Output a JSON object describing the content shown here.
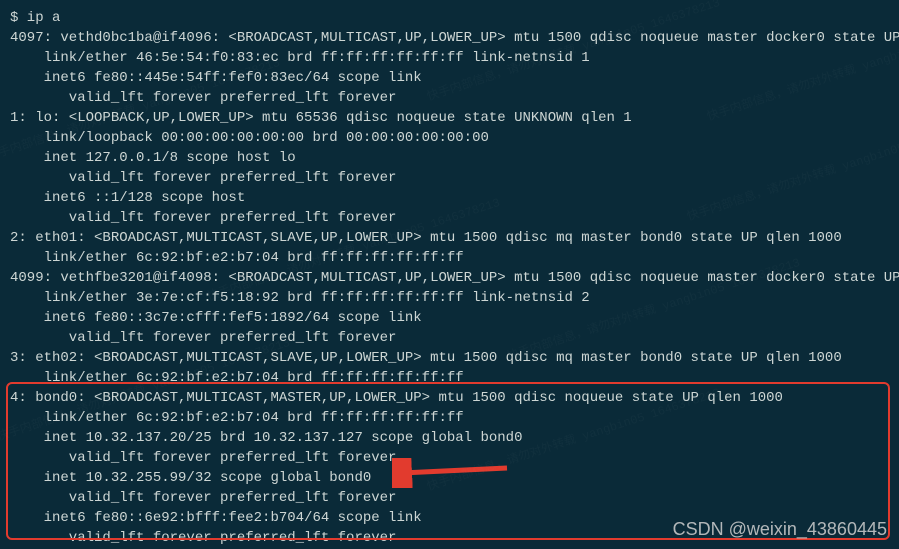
{
  "prompt": "$ ip a",
  "lines": [
    "4097: vethd0bc1ba@if4096: <BROADCAST,MULTICAST,UP,LOWER_UP> mtu 1500 qdisc noqueue master docker0 state UP",
    "    link/ether 46:5e:54:f0:83:ec brd ff:ff:ff:ff:ff:ff link-netnsid 1",
    "    inet6 fe80::445e:54ff:fef0:83ec/64 scope link",
    "       valid_lft forever preferred_lft forever",
    "1: lo: <LOOPBACK,UP,LOWER_UP> mtu 65536 qdisc noqueue state UNKNOWN qlen 1",
    "    link/loopback 00:00:00:00:00:00 brd 00:00:00:00:00:00",
    "    inet 127.0.0.1/8 scope host lo",
    "       valid_lft forever preferred_lft forever",
    "    inet6 ::1/128 scope host",
    "       valid_lft forever preferred_lft forever",
    "2: eth01: <BROADCAST,MULTICAST,SLAVE,UP,LOWER_UP> mtu 1500 qdisc mq master bond0 state UP qlen 1000",
    "    link/ether 6c:92:bf:e2:b7:04 brd ff:ff:ff:ff:ff:ff",
    "4099: vethfbe3201@if4098: <BROADCAST,MULTICAST,UP,LOWER_UP> mtu 1500 qdisc noqueue master docker0 state UP",
    "    link/ether 3e:7e:cf:f5:18:92 brd ff:ff:ff:ff:ff:ff link-netnsid 2",
    "    inet6 fe80::3c7e:cfff:fef5:1892/64 scope link",
    "       valid_lft forever preferred_lft forever",
    "3: eth02: <BROADCAST,MULTICAST,SLAVE,UP,LOWER_UP> mtu 1500 qdisc mq master bond0 state UP qlen 1000",
    "    link/ether 6c:92:bf:e2:b7:04 brd ff:ff:ff:ff:ff:ff",
    "4: bond0: <BROADCAST,MULTICAST,MASTER,UP,LOWER_UP> mtu 1500 qdisc noqueue state UP qlen 1000",
    "    link/ether 6c:92:bf:e2:b7:04 brd ff:ff:ff:ff:ff:ff",
    "    inet 10.32.137.20/25 brd 10.32.137.127 scope global bond0",
    "       valid_lft forever preferred_lft forever",
    "    inet 10.32.255.99/32 scope global bond0",
    "       valid_lft forever preferred_lft forever",
    "    inet6 fe80::6e92:bfff:fee2:b704/64 scope link",
    "       valid_lft forever preferred_lft forever"
  ],
  "csdn_watermark": "CSDN @weixin_43860445",
  "faint_watermark": "快手内部信息，请勿对外转载\nyangbin05 1646378213"
}
